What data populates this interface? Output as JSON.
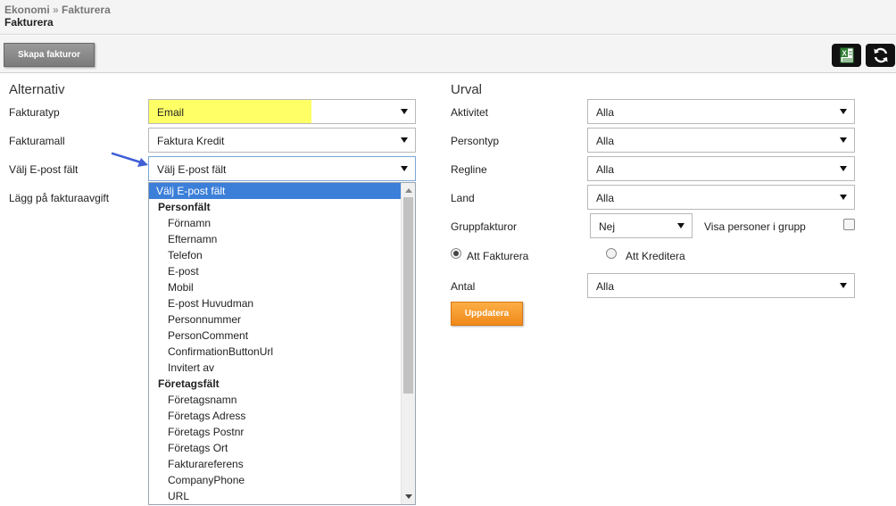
{
  "breadcrumb": {
    "parent": "Ekonomi",
    "separator": "»",
    "current": "Fakturera"
  },
  "page_title": "Fakturera",
  "toolbar": {
    "create_invoices_label": "Skapa fakturor",
    "excel_icon": "excel-icon",
    "refresh_icon": "refresh-icon"
  },
  "alternativ": {
    "title": "Alternativ",
    "fakturatyp": {
      "label": "Fakturatyp",
      "value": "Email",
      "highlight_color": "#ffff66"
    },
    "fakturamall": {
      "label": "Fakturamall",
      "value": "Faktura Kredit"
    },
    "email_field": {
      "label": "Välj E-post fält",
      "value": "Välj E-post fält"
    },
    "invoice_fee": {
      "label": "Lägg på fakturaavgift"
    }
  },
  "dropdown": {
    "selected": "Välj E-post fält",
    "groups": [
      {
        "label": "Personfält",
        "options": [
          "Förnamn",
          "Efternamn",
          "Telefon",
          "E-post",
          "Mobil",
          "E-post Huvudman",
          "Personnummer",
          "PersonComment",
          "ConfirmationButtonUrl",
          "Invitert av"
        ]
      },
      {
        "label": "Företagsfält",
        "options": [
          "Företagsnamn",
          "Företags Adress",
          "Företags Postnr",
          "Företags Ort",
          "Fakturareferens",
          "CompanyPhone",
          "URL"
        ]
      }
    ],
    "selected_color": "#3b7fd9"
  },
  "urval": {
    "title": "Urval",
    "aktivitet": {
      "label": "Aktivitet",
      "value": "Alla"
    },
    "persontyp": {
      "label": "Persontyp",
      "value": "Alla"
    },
    "regline": {
      "label": "Regline",
      "value": "Alla"
    },
    "land": {
      "label": "Land",
      "value": "Alla"
    },
    "gruppfakturor": {
      "label": "Gruppfakturor",
      "value": "Nej"
    },
    "visa_personer": {
      "label": "Visa personer i grupp",
      "checked": false
    },
    "att_fakturera": {
      "label": "Att Fakturera",
      "checked": true
    },
    "att_kreditera": {
      "label": "Att Kreditera",
      "checked": false
    },
    "antal": {
      "label": "Antal",
      "value": "Alla"
    },
    "update_label": "Uppdatera"
  },
  "colors": {
    "update_button": "#f0891a",
    "arrow": "#3f5fd6"
  }
}
